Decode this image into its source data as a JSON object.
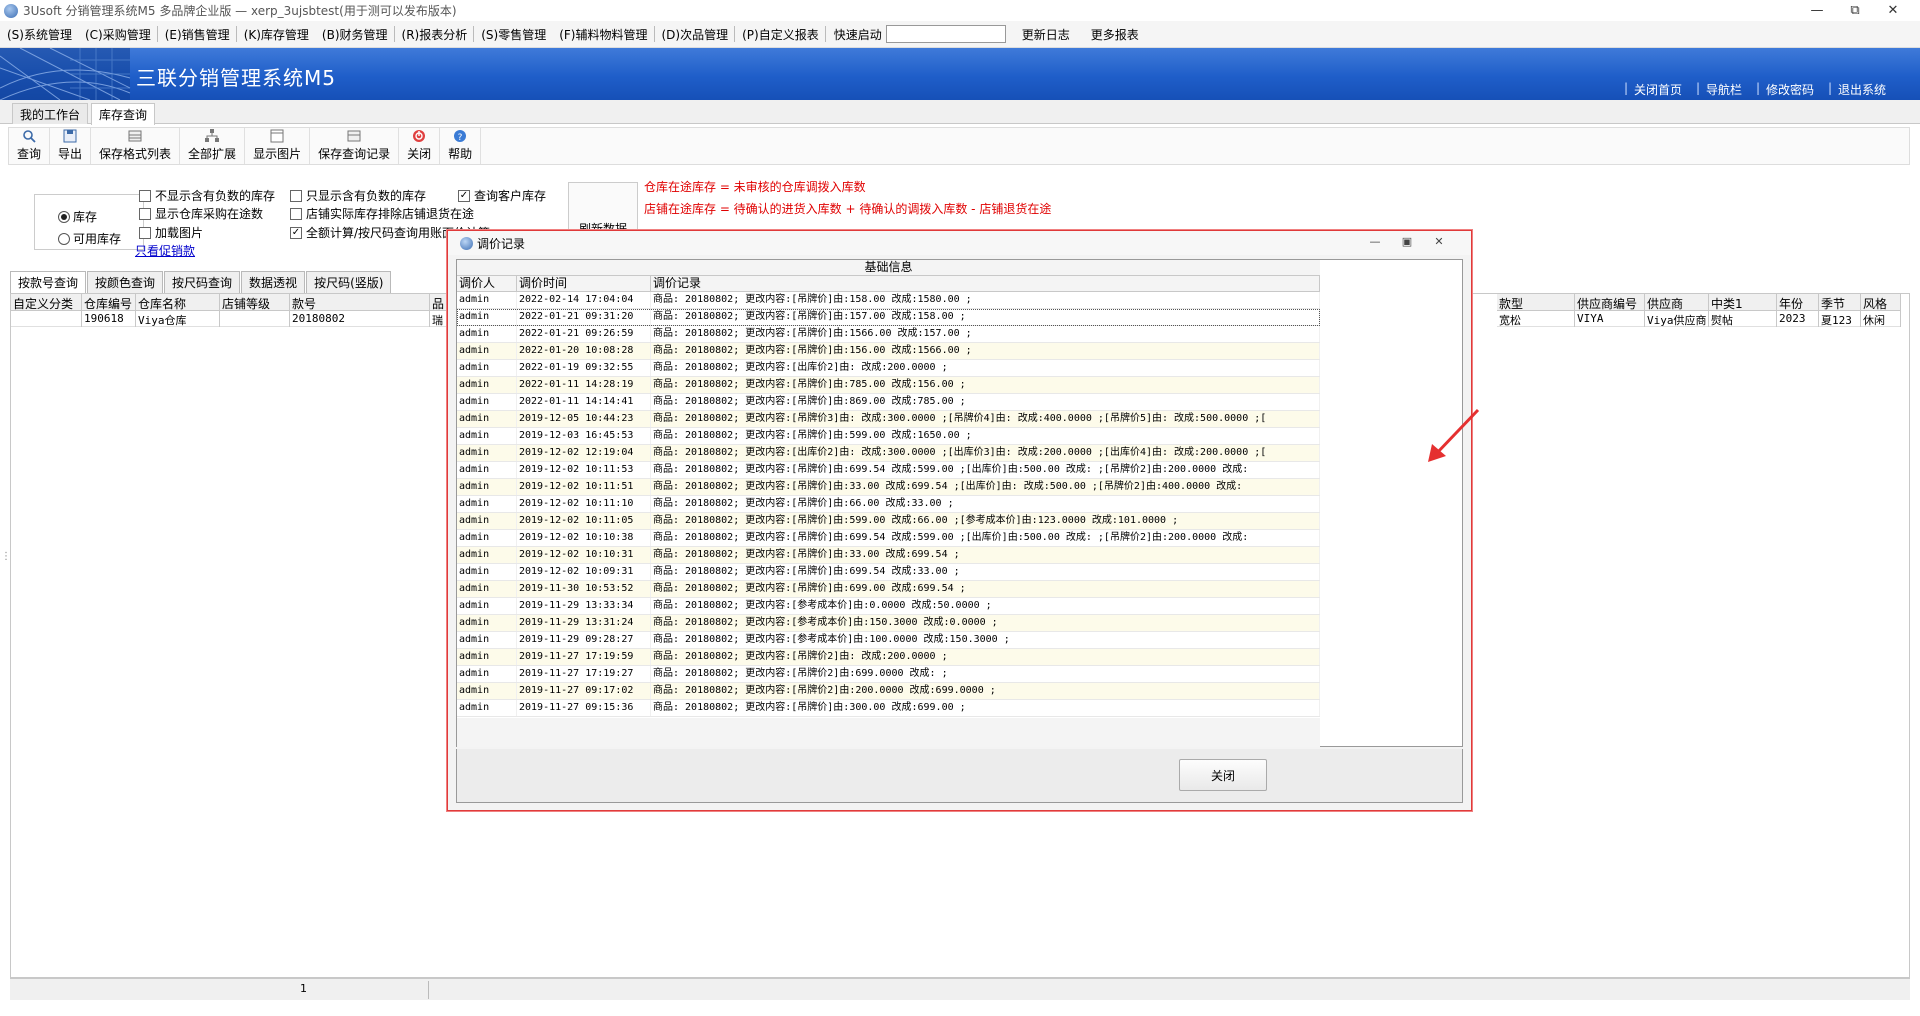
{
  "window": {
    "title": "3Usoft 分销管理系统M5 多品牌企业版 — xerp_3ujsbtest(用于测可以发布版本)",
    "controls": [
      "—",
      "⧉",
      "✕"
    ]
  },
  "menu": {
    "items": [
      "(S)系统管理",
      "(C)采购管理",
      "(E)销售管理",
      "(K)库存管理",
      "(B)财务管理",
      "(R)报表分析",
      "(S)零售管理",
      "(F)辅料物料管理",
      "(D)次品管理",
      "(P)自定义报表"
    ],
    "quick_label": "快速启动",
    "quick_value": "",
    "update_log": "更新日志",
    "more_reports": "更多报表"
  },
  "banner": {
    "app_name": "三联分销管理系统M5",
    "links": [
      "关闭首页",
      "导航栏",
      "修改密码",
      "退出系统"
    ]
  },
  "work_tabs": [
    "我的工作台",
    "库存查询"
  ],
  "toolbar": {
    "buttons": [
      {
        "label": "查询",
        "icon": "search-icon"
      },
      {
        "label": "导出",
        "icon": "export-icon"
      },
      {
        "label": "保存格式列表",
        "icon": "save-format-icon"
      },
      {
        "label": "全部扩展",
        "icon": "expand-all-icon"
      },
      {
        "label": "显示图片",
        "icon": "image-icon"
      },
      {
        "label": "保存查询记录",
        "icon": "save-query-icon"
      },
      {
        "label": "关闭",
        "icon": "close-icon"
      },
      {
        "label": "帮助",
        "icon": "help-icon"
      }
    ]
  },
  "filters": {
    "radio_stock": "库存",
    "radio_available": "可用库存",
    "chk_no_negative": "不显示含有负数的库存",
    "chk_show_purchase_transit": "显示仓库采购在途数",
    "chk_load_image": "加载图片",
    "chk_only_negative": "只显示含有负数的库存",
    "chk_exclude_return": "店铺实际库存排除店铺退货在途",
    "chk_all_amount": "全额计算/按尺码查询用账面价计算",
    "chk_customer_stock": "查询客户库存",
    "promo_link": "只看促销款",
    "refresh": "刷新数据",
    "note_warehouse": "仓库在途库存 = 未审核的仓库调拨入库数",
    "note_store": "店铺在途库存 = 待确认的进货入库数 + 待确认的调拨入库数 - 店铺退货在途"
  },
  "query_tabs": [
    "按款号查询",
    "按颜色查询",
    "按尺码查询",
    "数据透视",
    "按尺码(竖版)"
  ],
  "grid": {
    "headers_left": [
      "自定义分类",
      "仓库编号",
      "仓库名称",
      "店铺等级",
      "款号",
      "品"
    ],
    "headers_right": [
      "款型",
      "供应商编号",
      "供应商",
      "中类1",
      "年份",
      "季节",
      "风格"
    ],
    "row_left": [
      "",
      "190618",
      "Viya仓库",
      "",
      "20180802",
      "瑞"
    ],
    "row_right": [
      "宽松",
      "VIYA",
      "Viya供应商",
      "熨帖",
      "2023",
      "夏123",
      "休闲"
    ]
  },
  "status": {
    "page": "1"
  },
  "dialog": {
    "title": "调价记录",
    "group_header": "基础信息",
    "columns": [
      "调价人",
      "调价时间",
      "调价记录"
    ],
    "close_label": "关闭",
    "rows": [
      {
        "user": "admin",
        "time": "2022-02-14 17:04:04",
        "record": "商品: 20180802; 更改内容:[吊牌价]由:158.00 改成:1580.00 ;"
      },
      {
        "user": "admin",
        "time": "2022-01-21 09:31:20",
        "record": "商品: 20180802; 更改内容:[吊牌价]由:157.00 改成:158.00 ;"
      },
      {
        "user": "admin",
        "time": "2022-01-21 09:26:59",
        "record": "商品: 20180802; 更改内容:[吊牌价]由:1566.00 改成:157.00 ;"
      },
      {
        "user": "admin",
        "time": "2022-01-20 10:08:28",
        "record": "商品: 20180802; 更改内容:[吊牌价]由:156.00 改成:1566.00 ;"
      },
      {
        "user": "admin",
        "time": "2022-01-19 09:32:55",
        "record": "商品: 20180802; 更改内容:[出库价2]由: 改成:200.0000 ;"
      },
      {
        "user": "admin",
        "time": "2022-01-11 14:28:19",
        "record": "商品: 20180802; 更改内容:[吊牌价]由:785.00 改成:156.00 ;"
      },
      {
        "user": "admin",
        "time": "2022-01-11 14:14:41",
        "record": "商品: 20180802; 更改内容:[吊牌价]由:869.00 改成:785.00 ;"
      },
      {
        "user": "admin",
        "time": "2019-12-05 10:44:23",
        "record": "商品: 20180802; 更改内容:[吊牌价3]由: 改成:300.0000 ;[吊牌价4]由: 改成:400.0000 ;[吊牌价5]由: 改成:500.0000 ;["
      },
      {
        "user": "admin",
        "time": "2019-12-03 16:45:53",
        "record": "商品: 20180802; 更改内容:[吊牌价]由:599.00 改成:1650.00 ;"
      },
      {
        "user": "admin",
        "time": "2019-12-02 12:19:04",
        "record": "商品: 20180802; 更改内容:[出库价2]由: 改成:300.0000 ;[出库价3]由: 改成:200.0000 ;[出库价4]由: 改成:200.0000 ;["
      },
      {
        "user": "admin",
        "time": "2019-12-02 10:11:53",
        "record": "商品: 20180802; 更改内容:[吊牌价]由:699.54 改成:599.00 ;[出库价]由:500.00 改成: ;[吊牌价2]由:200.0000 改成:"
      },
      {
        "user": "admin",
        "time": "2019-12-02 10:11:51",
        "record": "商品: 20180802; 更改内容:[吊牌价]由:33.00 改成:699.54 ;[出库价]由: 改成:500.00 ;[吊牌价2]由:400.0000 改成:"
      },
      {
        "user": "admin",
        "time": "2019-12-02 10:11:10",
        "record": "商品: 20180802; 更改内容:[吊牌价]由:66.00 改成:33.00 ;"
      },
      {
        "user": "admin",
        "time": "2019-12-02 10:11:05",
        "record": "商品: 20180802; 更改内容:[吊牌价]由:599.00 改成:66.00 ;[参考成本价]由:123.0000 改成:101.0000 ;"
      },
      {
        "user": "admin",
        "time": "2019-12-02 10:10:38",
        "record": "商品: 20180802; 更改内容:[吊牌价]由:699.54 改成:599.00 ;[出库价]由:500.00 改成: ;[吊牌价2]由:200.0000 改成:"
      },
      {
        "user": "admin",
        "time": "2019-12-02 10:10:31",
        "record": "商品: 20180802; 更改内容:[吊牌价]由:33.00 改成:699.54 ;"
      },
      {
        "user": "admin",
        "time": "2019-12-02 10:09:31",
        "record": "商品: 20180802; 更改内容:[吊牌价]由:699.54 改成:33.00 ;"
      },
      {
        "user": "admin",
        "time": "2019-11-30 10:53:52",
        "record": "商品: 20180802; 更改内容:[吊牌价]由:699.00 改成:699.54 ;"
      },
      {
        "user": "admin",
        "time": "2019-11-29 13:33:34",
        "record": "商品: 20180802; 更改内容:[参考成本价]由:0.0000 改成:50.0000 ;"
      },
      {
        "user": "admin",
        "time": "2019-11-29 13:31:24",
        "record": "商品: 20180802; 更改内容:[参考成本价]由:150.3000 改成:0.0000 ;"
      },
      {
        "user": "admin",
        "time": "2019-11-29 09:28:27",
        "record": "商品: 20180802; 更改内容:[参考成本价]由:100.0000 改成:150.3000 ;"
      },
      {
        "user": "admin",
        "time": "2019-11-27 17:19:59",
        "record": "商品: 20180802; 更改内容:[吊牌价2]由: 改成:200.0000 ;"
      },
      {
        "user": "admin",
        "time": "2019-11-27 17:19:27",
        "record": "商品: 20180802; 更改内容:[吊牌价2]由:699.0000 改成: ;"
      },
      {
        "user": "admin",
        "time": "2019-11-27 09:17:02",
        "record": "商品: 20180802; 更改内容:[吊牌价2]由:200.0000 改成:699.0000 ;"
      },
      {
        "user": "admin",
        "time": "2019-11-27 09:15:36",
        "record": "商品: 20180802; 更改内容:[吊牌价]由:300.00 改成:699.00 ;"
      }
    ]
  },
  "colors": {
    "banner": "#1f5ec9",
    "note_red": "#e00000",
    "dialog_border": "#e03a3a",
    "arrow": "#e53030",
    "row_alt": "#fdfbea"
  }
}
